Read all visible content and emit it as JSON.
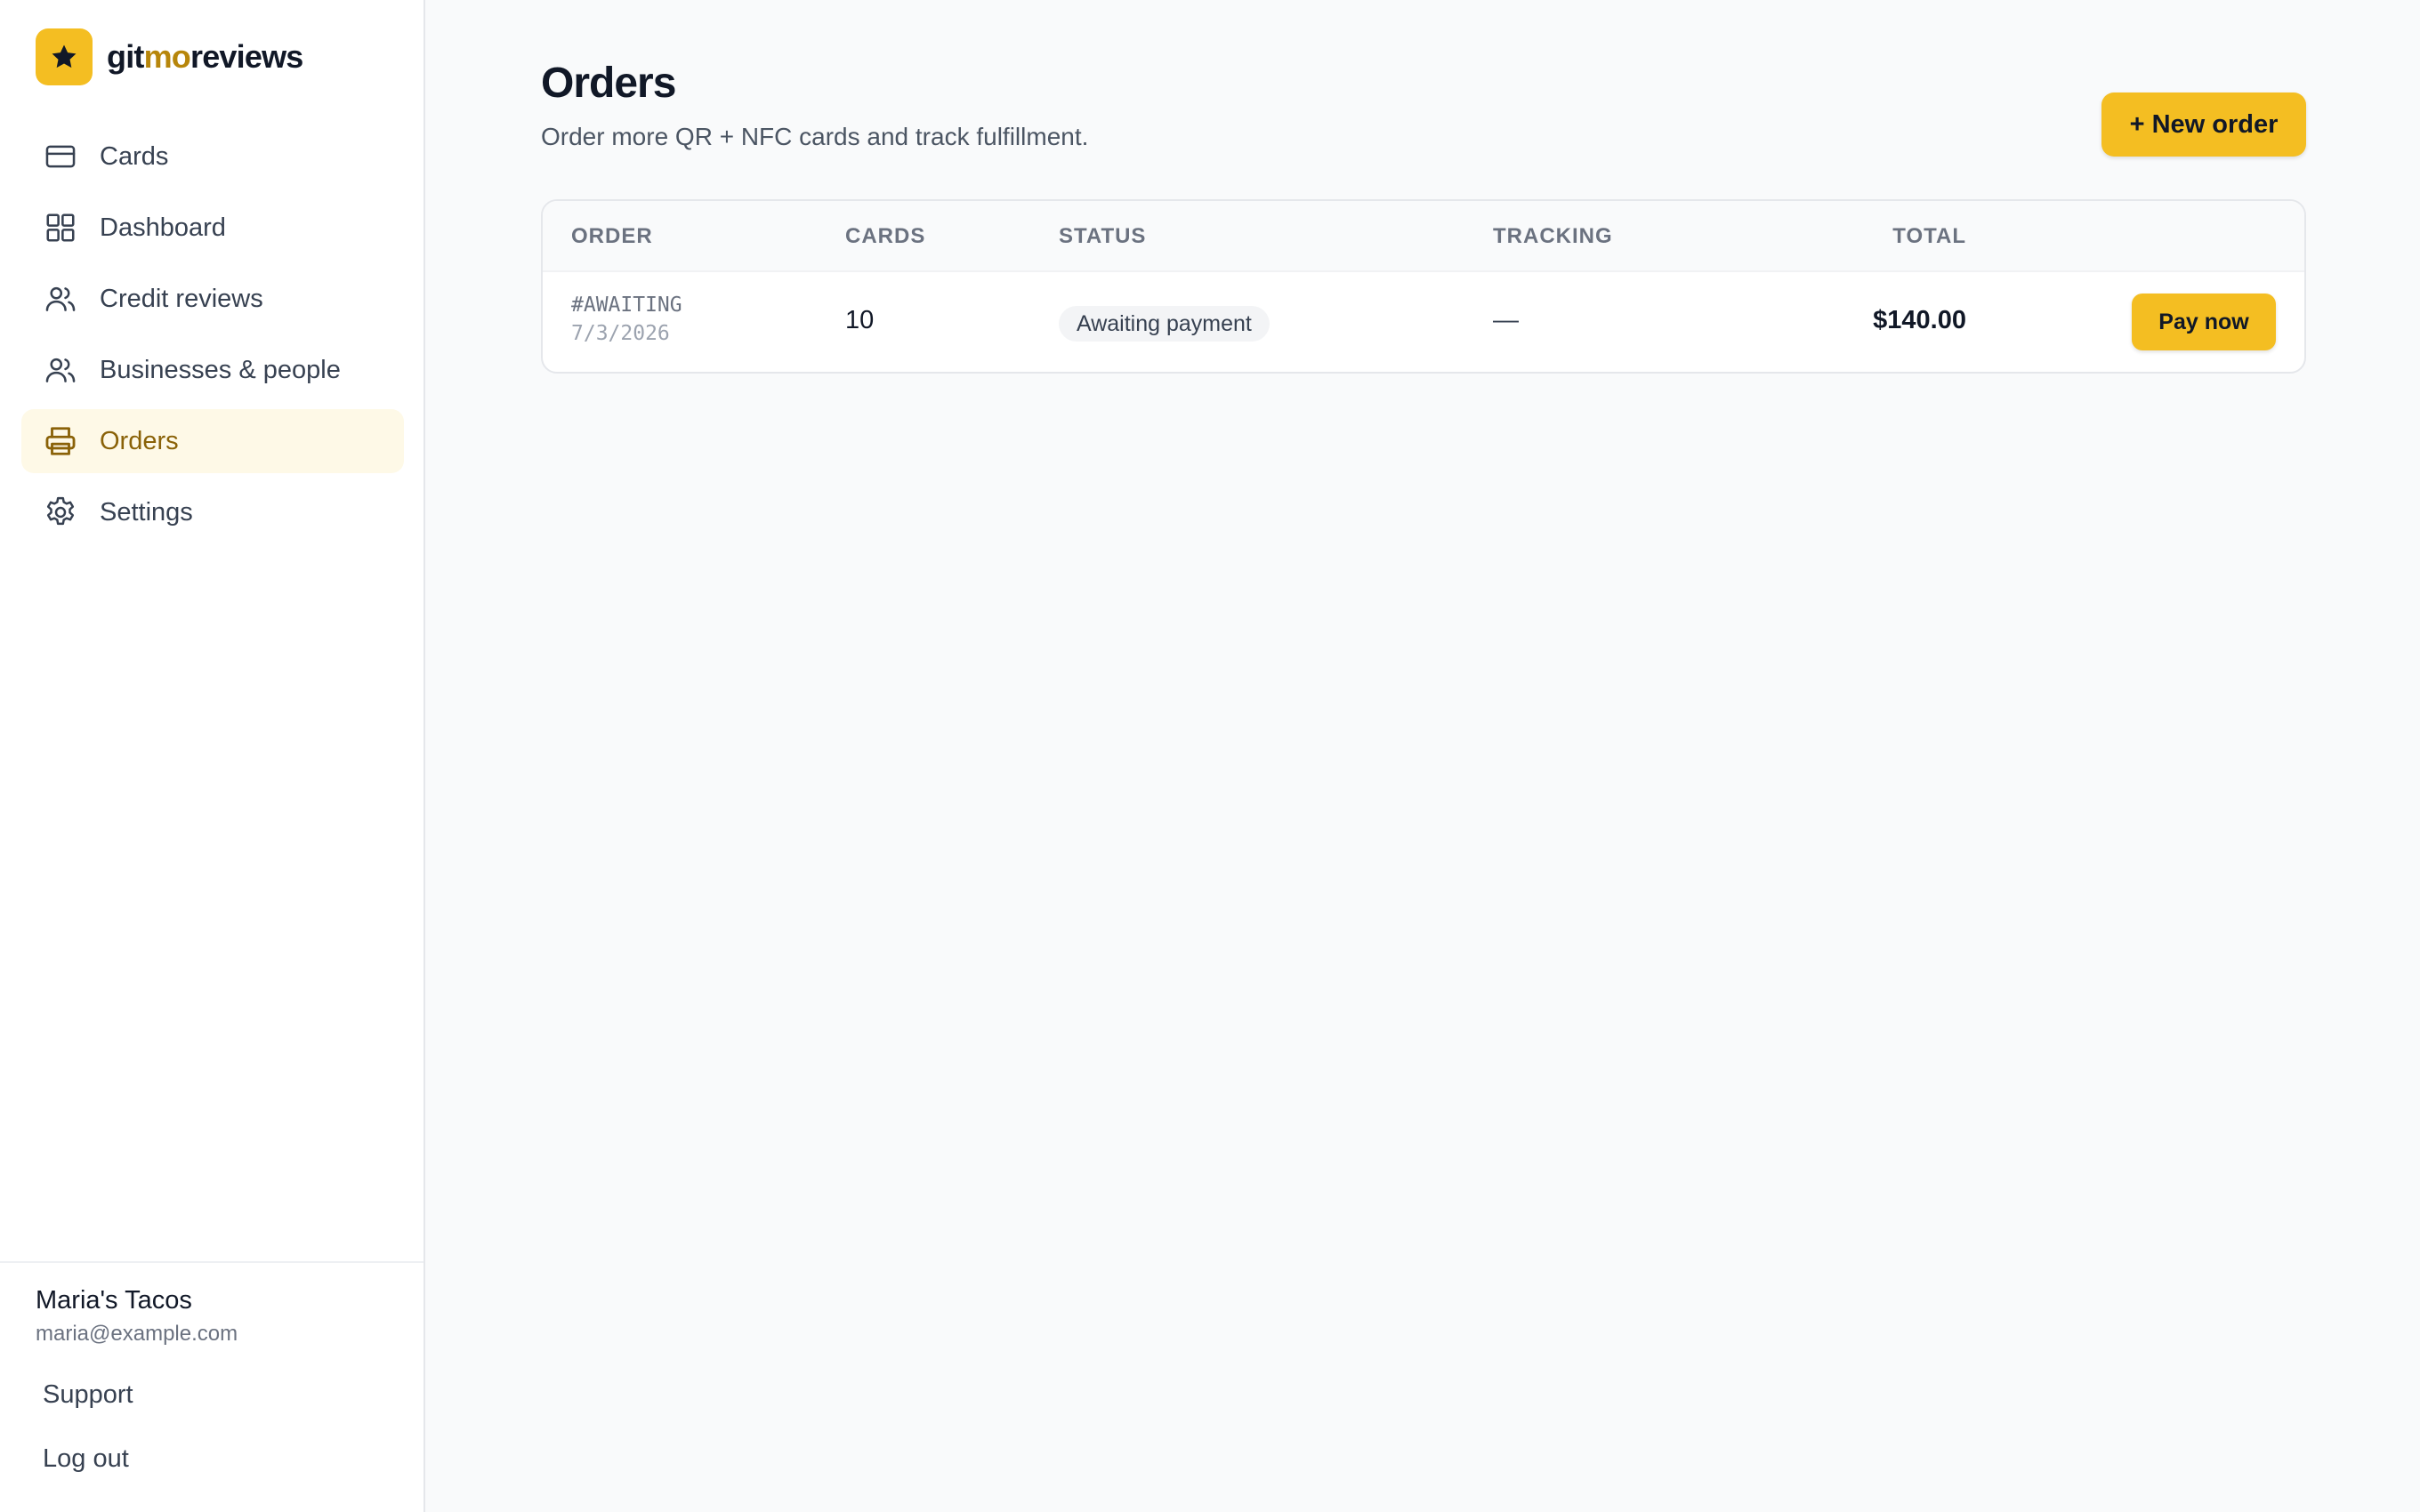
{
  "brand": {
    "name_part1": "git",
    "name_accent": "mo",
    "name_part2": "reviews",
    "accent_color": "#f4be22"
  },
  "sidebar": {
    "items": [
      {
        "label": "Cards",
        "icon": "credit-card-icon"
      },
      {
        "label": "Dashboard",
        "icon": "grid-icon"
      },
      {
        "label": "Credit reviews",
        "icon": "users-icon"
      },
      {
        "label": "Businesses & people",
        "icon": "users-icon"
      },
      {
        "label": "Orders",
        "icon": "printer-icon",
        "active": true
      },
      {
        "label": "Settings",
        "icon": "gear-icon"
      }
    ]
  },
  "account": {
    "name": "Maria's Tacos",
    "email": "maria@example.com",
    "support_label": "Support",
    "logout_label": "Log out"
  },
  "page": {
    "title": "Orders",
    "subtitle": "Order more QR + NFC cards and track fulfillment.",
    "new_order_label": "+ New order"
  },
  "table": {
    "headers": [
      "ORDER",
      "CARDS",
      "STATUS",
      "TRACKING",
      "TOTAL"
    ],
    "rows": [
      {
        "order_id": "#AWAITING",
        "date": "7/3/2026",
        "cards": "10",
        "status": "Awaiting payment",
        "tracking": "—",
        "total": "$140.00",
        "action_label": "Pay now"
      }
    ]
  }
}
